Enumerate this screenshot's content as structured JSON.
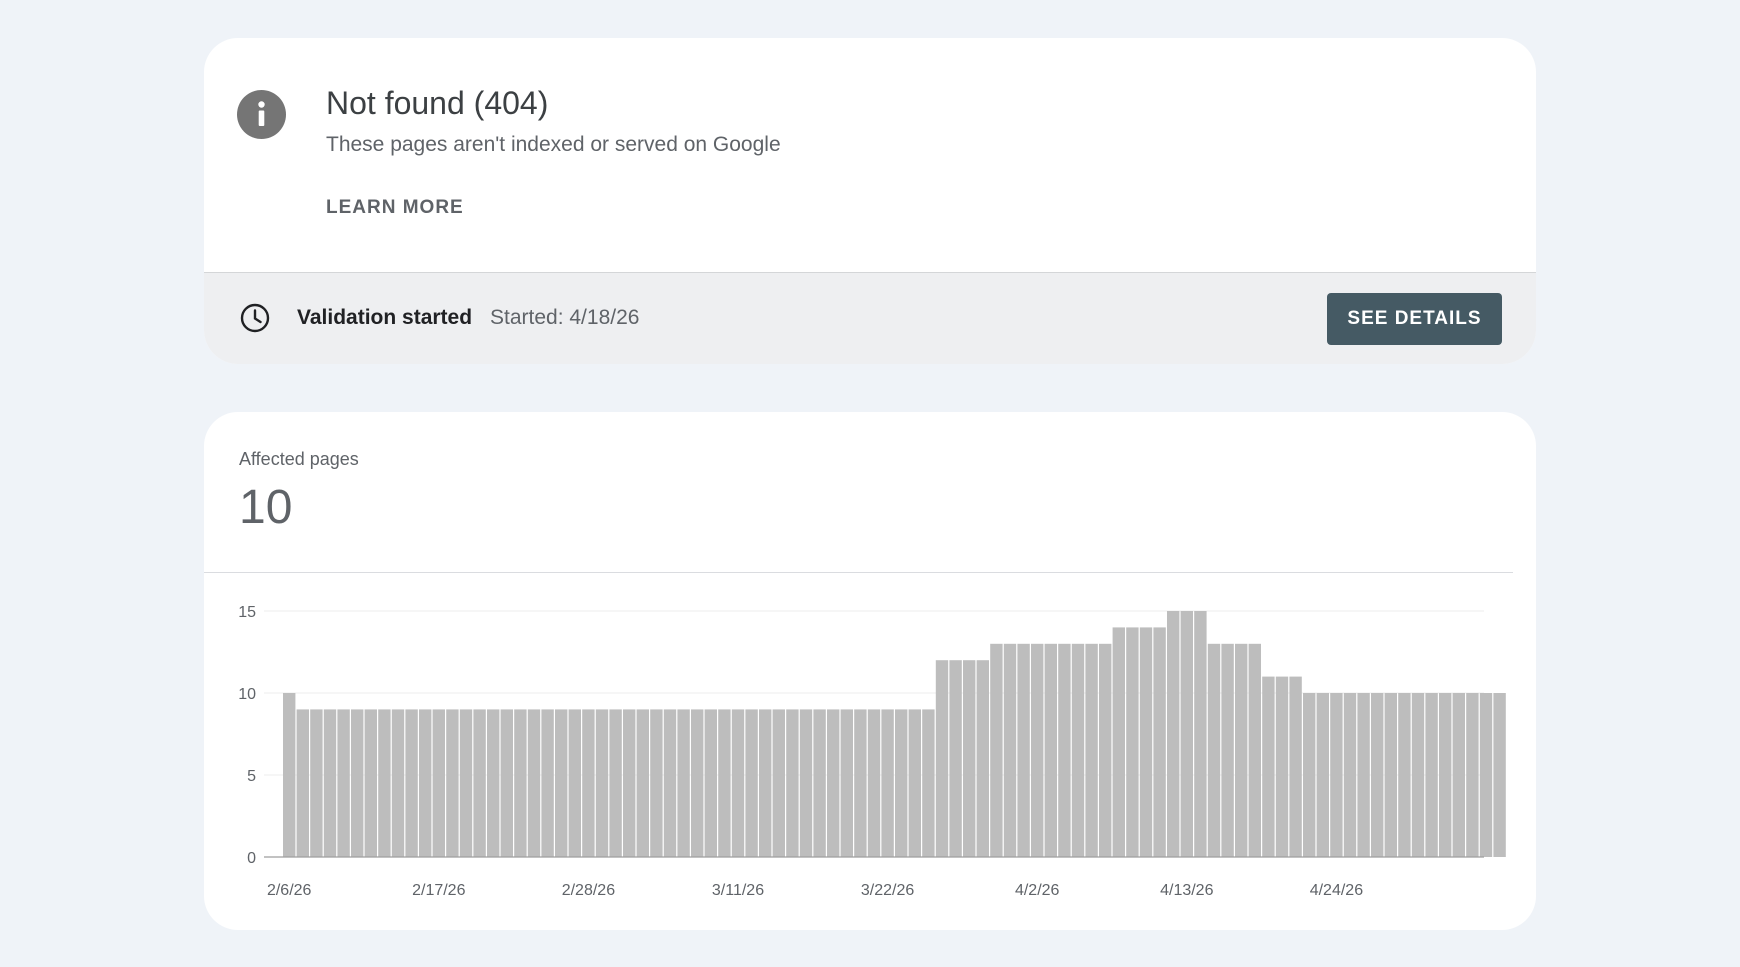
{
  "issue": {
    "title": "Not found (404)",
    "subtitle": "These pages aren't indexed or served on Google",
    "learn_more_label": "LEARN MORE",
    "icon": "info-icon"
  },
  "validation": {
    "status": "Validation started",
    "started": "Started: 4/18/26",
    "see_details_label": "SEE DETAILS",
    "icon": "clock-icon"
  },
  "metric": {
    "label": "Affected pages",
    "value": "10"
  },
  "colors": {
    "background": "#eff3f8",
    "button": "#455a64",
    "bar": "#bdbdbd",
    "icon": "#757575"
  },
  "chart_data": {
    "type": "bar",
    "start_date": "2/6/26",
    "x_tick_labels": [
      "2/6/26",
      "2/17/26",
      "2/28/26",
      "3/11/26",
      "3/22/26",
      "4/2/26",
      "4/13/26",
      "4/24/26"
    ],
    "y_ticks": [
      0,
      5,
      10,
      15
    ],
    "ylim": [
      0,
      15
    ],
    "grid": true,
    "values": [
      10,
      9,
      9,
      9,
      9,
      9,
      9,
      9,
      9,
      9,
      9,
      9,
      9,
      9,
      9,
      9,
      9,
      9,
      9,
      9,
      9,
      9,
      9,
      9,
      9,
      9,
      9,
      9,
      9,
      9,
      9,
      9,
      9,
      9,
      9,
      9,
      9,
      9,
      9,
      9,
      9,
      9,
      9,
      9,
      9,
      9,
      9,
      9,
      12,
      12,
      12,
      12,
      13,
      13,
      13,
      13,
      13,
      13,
      13,
      13,
      13,
      14,
      14,
      14,
      14,
      15,
      15,
      15,
      13,
      13,
      13,
      13,
      11,
      11,
      11,
      10,
      10,
      10,
      10,
      10,
      10,
      10,
      10,
      10,
      10,
      10,
      10,
      10,
      10,
      10
    ]
  }
}
